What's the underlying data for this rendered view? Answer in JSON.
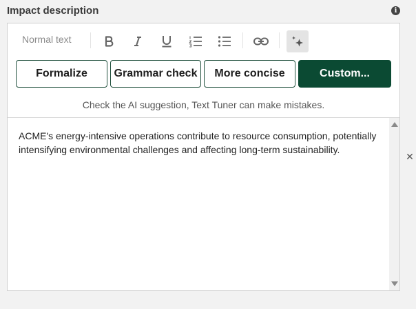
{
  "field": {
    "label": "Impact description"
  },
  "toolbar": {
    "text_style": "Normal text"
  },
  "ai_actions": {
    "formalize": "Formalize",
    "grammar_check": "Grammar check",
    "more_concise": "More concise",
    "custom": "Custom..."
  },
  "disclaimer": "Check the AI suggestion, Text Tuner can make mistakes.",
  "editor": {
    "content": "ACME's energy-intensive operations contribute to resource consumption, potentially intensifying environmental challenges and affecting long-term sustainability."
  },
  "colors": {
    "accent": "#0b4a33",
    "page_background": "#f2f2f2"
  },
  "icons": [
    "info-icon",
    "bold-icon",
    "italic-icon",
    "underline-icon",
    "ordered-list-icon",
    "bullet-list-icon",
    "link-icon",
    "ai-sparkle-icon",
    "scroll-up-icon",
    "scroll-down-icon",
    "close-icon"
  ]
}
